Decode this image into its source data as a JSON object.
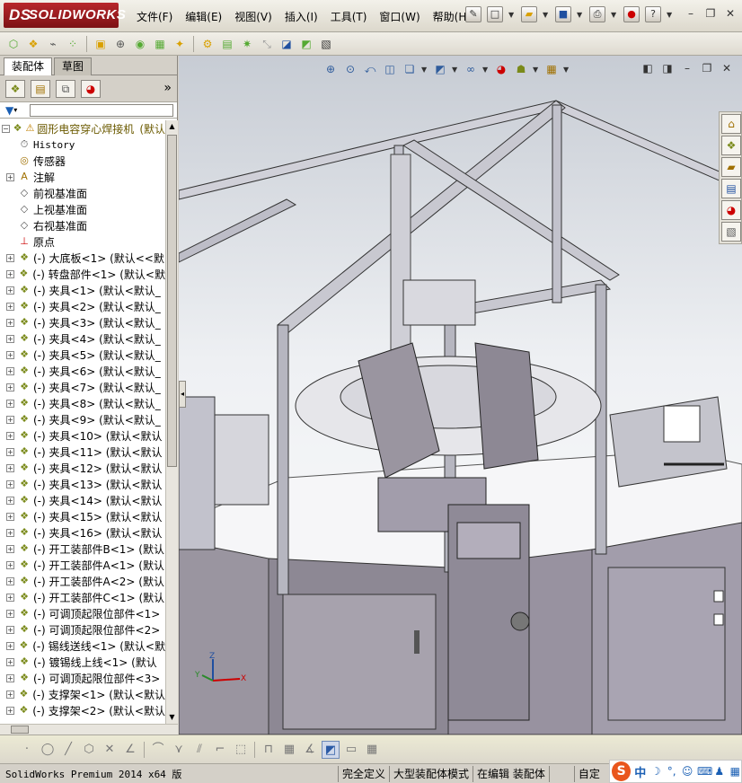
{
  "app": {
    "logo_ds": "DS",
    "logo_text": "SOLIDWORKS"
  },
  "menu": [
    "文件(F)",
    "编辑(E)",
    "视图(V)",
    "插入(I)",
    "工具(T)",
    "窗口(W)",
    "帮助(H)"
  ],
  "tabs": {
    "assembly": "装配体",
    "sketch": "草图"
  },
  "tree": {
    "root": {
      "label": "圆形电容穿心焊接机",
      "suffix": "(默认"
    },
    "items": [
      {
        "label": "History",
        "icon": "history-icon",
        "expand": false,
        "mono": true
      },
      {
        "label": "传感器",
        "icon": "sensor-icon",
        "expand": false
      },
      {
        "label": "注解",
        "icon": "annotation-icon",
        "expand": true
      },
      {
        "label": "前视基准面",
        "icon": "plane-icon",
        "expand": false
      },
      {
        "label": "上视基准面",
        "icon": "plane-icon",
        "expand": false
      },
      {
        "label": "右视基准面",
        "icon": "plane-icon",
        "expand": false
      },
      {
        "label": "原点",
        "icon": "origin-icon",
        "expand": false
      },
      {
        "label": "(-) 大底板<1> (默认<<默",
        "icon": "part-icon",
        "expand": true
      },
      {
        "label": "(-) 转盘部件<1> (默认<默",
        "icon": "part-icon",
        "expand": true
      },
      {
        "label": "(-) 夹具<1> (默认<默认_",
        "icon": "part-icon",
        "expand": true
      },
      {
        "label": "(-) 夹具<2> (默认<默认_",
        "icon": "part-icon",
        "expand": true
      },
      {
        "label": "(-) 夹具<3> (默认<默认_",
        "icon": "part-icon",
        "expand": true
      },
      {
        "label": "(-) 夹具<4> (默认<默认_",
        "icon": "part-icon",
        "expand": true
      },
      {
        "label": "(-) 夹具<5> (默认<默认_",
        "icon": "part-icon",
        "expand": true
      },
      {
        "label": "(-) 夹具<6> (默认<默认_",
        "icon": "part-icon",
        "expand": true
      },
      {
        "label": "(-) 夹具<7> (默认<默认_",
        "icon": "part-icon",
        "expand": true
      },
      {
        "label": "(-) 夹具<8> (默认<默认_",
        "icon": "part-icon",
        "expand": true
      },
      {
        "label": "(-) 夹具<9> (默认<默认_",
        "icon": "part-icon",
        "expand": true
      },
      {
        "label": "(-) 夹具<10> (默认<默认",
        "icon": "part-icon",
        "expand": true
      },
      {
        "label": "(-) 夹具<11> (默认<默认",
        "icon": "part-icon",
        "expand": true
      },
      {
        "label": "(-) 夹具<12> (默认<默认",
        "icon": "part-icon",
        "expand": true
      },
      {
        "label": "(-) 夹具<13> (默认<默认",
        "icon": "part-icon",
        "expand": true
      },
      {
        "label": "(-) 夹具<14> (默认<默认",
        "icon": "part-icon",
        "expand": true
      },
      {
        "label": "(-) 夹具<15> (默认<默认",
        "icon": "part-icon",
        "expand": true
      },
      {
        "label": "(-) 夹具<16> (默认<默认",
        "icon": "part-icon",
        "expand": true
      },
      {
        "label": "(-) 开工装部件B<1> (默认",
        "icon": "part-icon",
        "expand": true
      },
      {
        "label": "(-) 开工装部件A<1> (默认",
        "icon": "part-icon",
        "expand": true
      },
      {
        "label": "(-) 开工装部件A<2> (默认",
        "icon": "part-icon",
        "expand": true
      },
      {
        "label": "(-) 开工装部件C<1> (默认",
        "icon": "part-icon",
        "expand": true
      },
      {
        "label": "(-) 可调顶起限位部件<1>",
        "icon": "part-icon",
        "expand": true
      },
      {
        "label": "(-) 可调顶起限位部件<2>",
        "icon": "part-icon",
        "expand": true
      },
      {
        "label": "(-) 锡线送线<1> (默认<默",
        "icon": "part-icon",
        "expand": true
      },
      {
        "label": "(-) 镀锡线上线<1> (默认",
        "icon": "part-icon",
        "expand": true
      },
      {
        "label": "(-) 可调顶起限位部件<3>",
        "icon": "part-icon",
        "expand": true
      },
      {
        "label": "(-) 支撑架<1> (默认<默认",
        "icon": "part-icon",
        "expand": true
      },
      {
        "label": "(-) 支撑架<2> (默认<默认",
        "icon": "part-icon",
        "expand": true
      }
    ]
  },
  "triad": {
    "z": "Z",
    "x": "X",
    "y": "Y"
  },
  "status": {
    "app": "SolidWorks Premium 2014 x64 版",
    "cells": [
      "完全定义",
      "大型装配体模式",
      "在编辑 装配体",
      "自定"
    ]
  },
  "ime": {
    "zh": "中"
  }
}
